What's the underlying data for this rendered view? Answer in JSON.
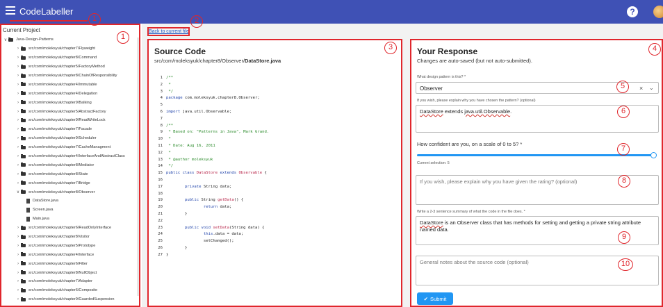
{
  "app": {
    "title": "CodeLabeller"
  },
  "sidebar": {
    "title": "Current Project",
    "root": "Java-Design-Patterns",
    "items": [
      {
        "label": "src/com/moleksyuk/chapter7/Flyweight",
        "type": "folder",
        "open": false
      },
      {
        "label": "src/com/moleksyuk/chapter8/Command",
        "type": "folder",
        "open": false
      },
      {
        "label": "src/com/moleksyuk/chapter5/FactoryMethod",
        "type": "folder",
        "open": false
      },
      {
        "label": "src/com/moleksyuk/chapter8/ChainOfResponsibility",
        "type": "folder",
        "open": false
      },
      {
        "label": "src/com/moleksyuk/chapter4/Immutable",
        "type": "folder",
        "open": false
      },
      {
        "label": "src/com/moleksyuk/chapter4/Delegation",
        "type": "folder",
        "open": false
      },
      {
        "label": "src/com/moleksyuk/chapter9/Balking",
        "type": "folder",
        "open": false
      },
      {
        "label": "src/com/moleksyuk/chapter5/AbstractFactory",
        "type": "folder",
        "open": false
      },
      {
        "label": "src/com/moleksyuk/chapter9/ReadWriteLock",
        "type": "folder",
        "open": false
      },
      {
        "label": "src/com/moleksyuk/chapter7/Facade",
        "type": "folder",
        "open": false
      },
      {
        "label": "src/com/moleksyuk/chapter9/Scheduler",
        "type": "folder",
        "open": false
      },
      {
        "label": "src/com/moleksyuk/chapter7/CacheManagment",
        "type": "folder",
        "open": false
      },
      {
        "label": "src/com/moleksyuk/chapter4/InterfaceAndAbstractClass",
        "type": "folder",
        "open": false
      },
      {
        "label": "src/com/moleksyuk/chapter8/Mediator",
        "type": "folder",
        "open": false
      },
      {
        "label": "src/com/moleksyuk/chapter8/State",
        "type": "folder",
        "open": false
      },
      {
        "label": "src/com/moleksyuk/chapter7/Bridge",
        "type": "folder",
        "open": false
      },
      {
        "label": "src/com/moleksyuk/chapter8/Observer",
        "type": "folder",
        "open": true
      },
      {
        "label": "DataStore.java",
        "type": "file"
      },
      {
        "label": "Screen.java",
        "type": "file"
      },
      {
        "label": "Main.java",
        "type": "file"
      },
      {
        "label": "src/com/moleksyuk/chapter6/ReadOnlyInterface",
        "type": "folder",
        "open": false
      },
      {
        "label": "src/com/moleksyuk/chapter8/Visitor",
        "type": "folder",
        "open": false
      },
      {
        "label": "src/com/moleksyuk/chapter5/Prototype",
        "type": "folder",
        "open": false
      },
      {
        "label": "src/com/moleksyuk/chapter4/Interface",
        "type": "folder",
        "open": false
      },
      {
        "label": "src/com/moleksyuk/chapter6/Filter",
        "type": "folder",
        "open": false
      },
      {
        "label": "src/com/moleksyuk/chapter8/NullObject",
        "type": "folder",
        "open": false
      },
      {
        "label": "src/com/moleksyuk/chapter7/Adapter",
        "type": "folder",
        "open": false
      },
      {
        "label": "src/com/moleksyuk/chapter6/Composite",
        "type": "folder",
        "open": false
      },
      {
        "label": "src/com/moleksyuk/chapter9/GuardedSuspension",
        "type": "folder",
        "open": false
      }
    ]
  },
  "back_link": "Back to current file",
  "source": {
    "title": "Source Code",
    "path_prefix": "src/com/moleksyuk/chapter8/Observer/",
    "path_file": "DataStore.java",
    "lines": [
      {
        "n": "1",
        "parts": [
          [
            "cm",
            "/**"
          ]
        ]
      },
      {
        "n": "2",
        "parts": [
          [
            "cm",
            " *"
          ]
        ]
      },
      {
        "n": "3",
        "parts": [
          [
            "cm",
            " */"
          ]
        ]
      },
      {
        "n": "4",
        "parts": [
          [
            "kw",
            "package"
          ],
          [
            "st",
            " com.moleksyuk.chapter8.Observer;"
          ]
        ]
      },
      {
        "n": "5",
        "parts": []
      },
      {
        "n": "6",
        "parts": [
          [
            "kw",
            "import"
          ],
          [
            "st",
            " java.util.Observable;"
          ]
        ]
      },
      {
        "n": "7",
        "parts": []
      },
      {
        "n": "8",
        "parts": [
          [
            "cm",
            "/**"
          ]
        ]
      },
      {
        "n": "9",
        "parts": [
          [
            "cm",
            " * Based on: \"Patterns in Java\", Mark Grand."
          ]
        ]
      },
      {
        "n": "10",
        "parts": [
          [
            "cm",
            " *"
          ]
        ]
      },
      {
        "n": "11",
        "parts": [
          [
            "cm",
            " * Date: Aug 16, 2011"
          ]
        ]
      },
      {
        "n": "12",
        "parts": [
          [
            "cm",
            " *"
          ]
        ]
      },
      {
        "n": "13",
        "parts": [
          [
            "cm",
            " * @author moleksyuk"
          ]
        ]
      },
      {
        "n": "14",
        "parts": [
          [
            "cm",
            " */"
          ]
        ]
      },
      {
        "n": "15",
        "parts": [
          [
            "kw",
            "public class"
          ],
          [
            "st",
            " "
          ],
          [
            "cls",
            "DataStore"
          ],
          [
            "st",
            " "
          ],
          [
            "kw",
            "extends"
          ],
          [
            "st",
            " "
          ],
          [
            "cls",
            "Observable"
          ],
          [
            "st",
            " {"
          ]
        ]
      },
      {
        "n": "16",
        "parts": []
      },
      {
        "n": "17",
        "parts": [
          [
            "st",
            "        "
          ],
          [
            "kw",
            "private"
          ],
          [
            "st",
            " String data;"
          ]
        ]
      },
      {
        "n": "18",
        "parts": []
      },
      {
        "n": "19",
        "parts": [
          [
            "st",
            "        "
          ],
          [
            "kw",
            "public"
          ],
          [
            "st",
            " String "
          ],
          [
            "fn",
            "getData"
          ],
          [
            "st",
            "() {"
          ]
        ]
      },
      {
        "n": "20",
        "parts": [
          [
            "st",
            "                "
          ],
          [
            "kw",
            "return"
          ],
          [
            "st",
            " data;"
          ]
        ]
      },
      {
        "n": "21",
        "parts": [
          [
            "st",
            "        }"
          ]
        ]
      },
      {
        "n": "22",
        "parts": []
      },
      {
        "n": "23",
        "parts": [
          [
            "st",
            "        "
          ],
          [
            "kw",
            "public void"
          ],
          [
            "st",
            " "
          ],
          [
            "fn",
            "setData"
          ],
          [
            "st",
            "(String data) {"
          ]
        ]
      },
      {
        "n": "24",
        "parts": [
          [
            "st",
            "                "
          ],
          [
            "kw",
            "this"
          ],
          [
            "st",
            ".data = data;"
          ]
        ]
      },
      {
        "n": "25",
        "parts": [
          [
            "st",
            "                setChanged();"
          ]
        ]
      },
      {
        "n": "26",
        "parts": [
          [
            "st",
            "        }"
          ]
        ]
      },
      {
        "n": "27",
        "parts": [
          [
            "st",
            "}"
          ]
        ]
      }
    ]
  },
  "response": {
    "title": "Your Response",
    "subtitle": "Changes are auto-saved (but not auto-submitted).",
    "pattern_label": "What design pattern is this? *",
    "pattern_value": "Observer",
    "pattern_clear": "×",
    "pattern_chevron": "⌄",
    "explain_label": "If you wish, please explain why you have chosen the pattern? (optional)",
    "explain_value_a": "DataStore",
    "explain_value_b": " extends ",
    "explain_value_c": "java.util.Observable",
    "explain_value_d": ".",
    "confidence_label": "How confident are you, on a scale of 0 to 5? *",
    "confidence_value": 5,
    "confidence_max": 5,
    "confidence_caption": "Current selection: 5",
    "rating_placeholder": "If you wish, please explain why you have given the rating? (optional)",
    "summary_label": "Write a 2-3 sentence summary of what the code in the file does. *",
    "summary_value_a": "DataStore",
    "summary_value_b": " is an Observer class that has methods for setting and getting a private string attribute named data.",
    "notes_placeholder": "General notes about the source code (optional)",
    "submit_icon": "✔",
    "submit_label": "Submit"
  },
  "annotations": [
    "1",
    "1",
    "2",
    "3",
    "4",
    "5",
    "6",
    "7",
    "8",
    "9",
    "10"
  ],
  "colors": {
    "topbar": "#3f51b5",
    "accent": "#2196f3",
    "annotation": "#e0262c"
  }
}
